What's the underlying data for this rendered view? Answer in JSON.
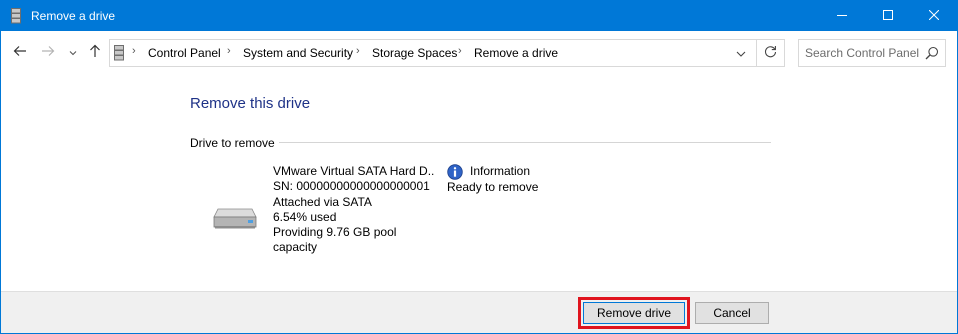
{
  "window": {
    "title": "Remove a drive",
    "icon": "storage-spaces-icon"
  },
  "caption_buttons": {
    "minimize_icon": "minimize-icon",
    "maximize_icon": "maximize-icon",
    "close_icon": "close-icon"
  },
  "navigation": {
    "back_icon": "arrow-left-icon",
    "forward_icon": "arrow-right-icon",
    "recent_icon": "chevron-down-icon",
    "up_icon": "arrow-up-icon"
  },
  "address_bar": {
    "breadcrumbs": [
      "Control Panel",
      "System and Security",
      "Storage Spaces",
      "Remove a drive"
    ],
    "separator": "›"
  },
  "search": {
    "placeholder": "Search Control Panel"
  },
  "main": {
    "title": "Remove this drive",
    "section_label": "Drive to remove",
    "drive": {
      "name": "VMware Virtual SATA Hard D...",
      "serial": "SN: 00000000000000000001",
      "connection": "Attached via SATA",
      "usage": "6.54% used",
      "capacity": "Providing 9.76 GB pool capacity"
    },
    "info": {
      "heading": "Information",
      "status": "Ready to remove"
    }
  },
  "footer": {
    "remove_label": "Remove drive",
    "cancel_label": "Cancel"
  },
  "colors": {
    "titlebar": "#0078d7",
    "title_text": "#1e3287",
    "highlight": "#e0141e",
    "footer_bg": "#f0f0f0"
  }
}
